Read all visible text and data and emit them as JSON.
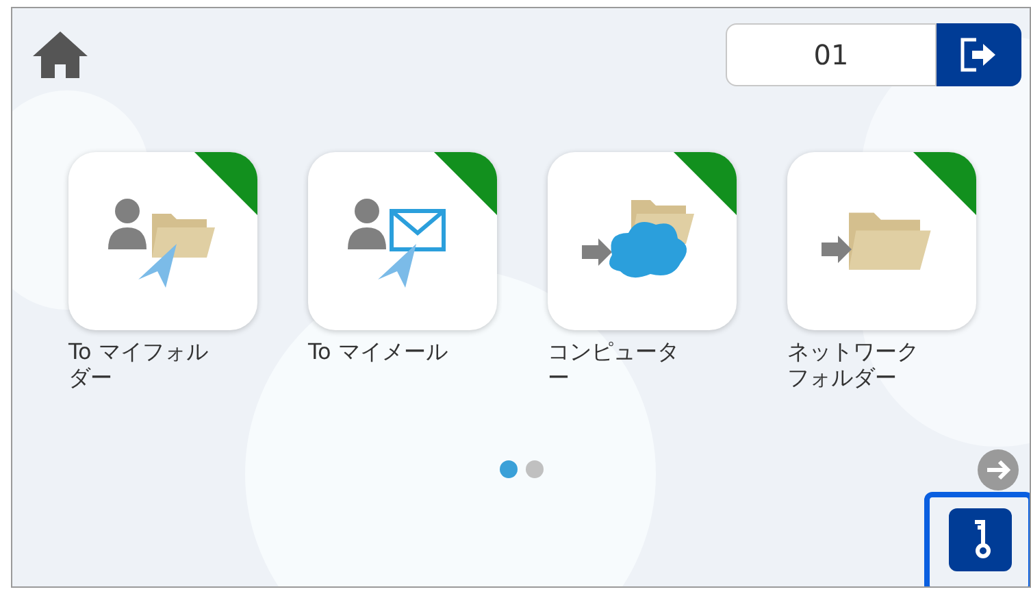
{
  "user_field": {
    "value": "01"
  },
  "destinations": [
    {
      "kind": "my-folder",
      "label": "To マイフォルダー",
      "flagged": true
    },
    {
      "kind": "my-mail",
      "label": "To マイメール",
      "flagged": true
    },
    {
      "kind": "computer",
      "label": "コンピューター",
      "flagged": true
    },
    {
      "kind": "network-folder",
      "label": "ネットワークフォルダー",
      "flagged": true
    }
  ],
  "pages": [
    {
      "selected": true
    },
    {
      "selected": false
    }
  ],
  "key_button": {
    "focused": true
  }
}
